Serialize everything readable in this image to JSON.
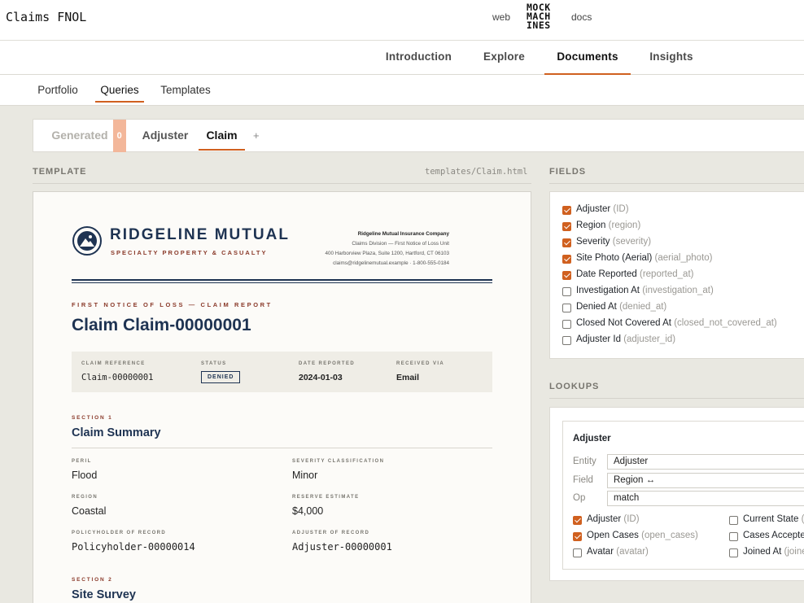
{
  "app": {
    "title": "Claims FNOL"
  },
  "toplinks": {
    "web": "web",
    "docs": "docs"
  },
  "logo": {
    "line1": "MOCK",
    "line2": "MACH",
    "line3": "INES"
  },
  "main_nav": [
    "Introduction",
    "Explore",
    "Documents",
    "Insights"
  ],
  "sub_nav": [
    "Portfolio",
    "Queries",
    "Templates"
  ],
  "doc_tabs": {
    "generated_label": "Generated",
    "generated_count": "0",
    "adjuster": "Adjuster",
    "claim": "Claim",
    "add": "+"
  },
  "template": {
    "label": "TEMPLATE",
    "path": "templates/Claim.html"
  },
  "doc": {
    "company": "RIDGELINE MUTUAL",
    "company_sub": "SPECIALTY PROPERTY & CASUALTY",
    "addr_name": "Ridgeline Mutual Insurance Company",
    "addr_line1": "Claims Division — First Notice of Loss Unit",
    "addr_line2": "400 Harborview Plaza, Suite 1200, Hartford, CT 06103",
    "addr_line3": "claims@ridgelinemutual.example · 1-800-555-0184",
    "kicker": "FIRST NOTICE OF LOSS — CLAIM REPORT",
    "title": "Claim Claim-00000001",
    "ref": {
      "claim_reference_label": "CLAIM REFERENCE",
      "claim_reference": "Claim-00000001",
      "status_label": "STATUS",
      "status": "DENIED",
      "date_reported_label": "DATE REPORTED",
      "date_reported": "2024-01-03",
      "received_via_label": "RECEIVED VIA",
      "received_via": "Email"
    },
    "section1": {
      "num": "SECTION 1",
      "title": "Claim Summary",
      "peril_label": "PERIL",
      "peril": "Flood",
      "severity_label": "SEVERITY CLASSIFICATION",
      "severity": "Minor",
      "region_label": "REGION",
      "region": "Coastal",
      "reserve_label": "RESERVE ESTIMATE",
      "reserve": "$4,000",
      "policyholder_label": "POLICYHOLDER OF RECORD",
      "policyholder": "Policyholder-00000014",
      "adjuster_label": "ADJUSTER OF RECORD",
      "adjuster": "Adjuster-00000001"
    },
    "section2": {
      "num": "SECTION 2",
      "title": "Site Survey"
    }
  },
  "fields": {
    "label": "FIELDS",
    "items": [
      {
        "name": "Adjuster",
        "key": "(ID)",
        "checked": true
      },
      {
        "name": "Region",
        "key": "(region)",
        "checked": true
      },
      {
        "name": "Severity",
        "key": "(severity)",
        "checked": true
      },
      {
        "name": "Site Photo (Aerial)",
        "key": "(aerial_photo)",
        "checked": true
      },
      {
        "name": "Date Reported",
        "key": "(reported_at)",
        "checked": true
      },
      {
        "name": "Investigation At",
        "key": "(investigation_at)",
        "checked": false
      },
      {
        "name": "Denied At",
        "key": "(denied_at)",
        "checked": false
      },
      {
        "name": "Closed Not Covered At",
        "key": "(closed_not_covered_at)",
        "checked": false
      },
      {
        "name": "Adjuster Id",
        "key": "(adjuster_id)",
        "checked": false
      }
    ]
  },
  "lookups": {
    "label": "LOOKUPS",
    "title": "Adjuster",
    "entity_label": "Entity",
    "entity": "Adjuster",
    "field_label": "Field",
    "field": "Region ↔",
    "op_label": "Op",
    "op": "match",
    "left_items": [
      {
        "name": "Adjuster",
        "key": "(ID)",
        "checked": true
      },
      {
        "name": "Open Cases",
        "key": "(open_cases)",
        "checked": true
      },
      {
        "name": "Avatar",
        "key": "(avatar)",
        "checked": false
      }
    ],
    "right_items": [
      {
        "name": "Current State",
        "key": "(c",
        "checked": false
      },
      {
        "name": "Cases Accepted",
        "key": "",
        "checked": false
      },
      {
        "name": "Joined At",
        "key": "(joine",
        "checked": false
      }
    ]
  },
  "colors": {
    "accent": "#d0601f",
    "navy": "#1e3352",
    "brick": "#8a3a2a",
    "canvas": "#e9e8e1"
  }
}
